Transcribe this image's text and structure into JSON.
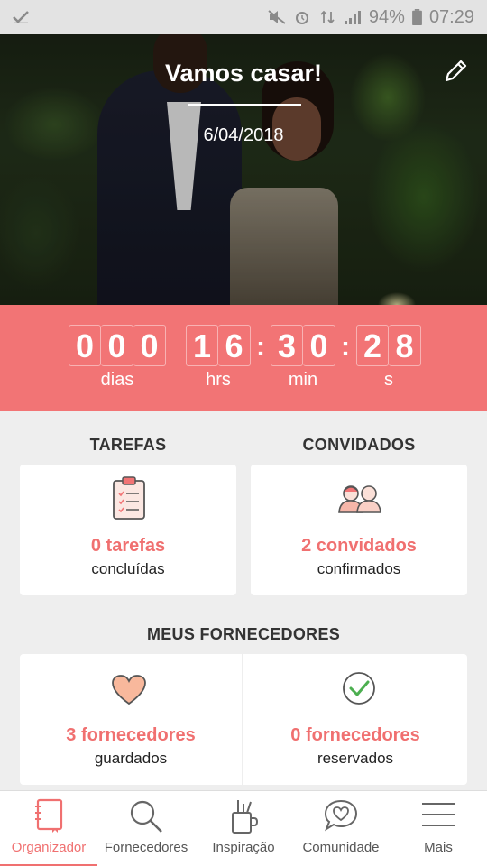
{
  "status_bar": {
    "battery": "94%",
    "time": "07:29"
  },
  "hero": {
    "title": "Vamos casar!",
    "date": "6/04/2018"
  },
  "countdown": {
    "days": [
      "0",
      "0",
      "0"
    ],
    "hours": [
      "1",
      "6"
    ],
    "minutes": [
      "3",
      "0"
    ],
    "seconds": [
      "2",
      "8"
    ],
    "labels": {
      "days": "dias",
      "hours": "hrs",
      "minutes": "min",
      "seconds": "s"
    }
  },
  "tasks": {
    "title": "TAREFAS",
    "value": "0 tarefas",
    "sub": "concluídas"
  },
  "guests": {
    "title": "CONVIDADOS",
    "value": "2 convidados",
    "sub": "confirmados"
  },
  "vendors": {
    "title": "MEUS FORNECEDORES",
    "saved": {
      "value": "3 fornecedores",
      "sub": "guardados"
    },
    "booked": {
      "value": "0 fornecedores",
      "sub": "reservados"
    }
  },
  "nav": {
    "items": [
      {
        "label": "Organizador",
        "icon": "notebook-icon",
        "active": true
      },
      {
        "label": "Fornecedores",
        "icon": "search-icon",
        "active": false
      },
      {
        "label": "Inspiração",
        "icon": "inspiration-icon",
        "active": false
      },
      {
        "label": "Comunidade",
        "icon": "chat-heart-icon",
        "active": false
      },
      {
        "label": "Mais",
        "icon": "menu-icon",
        "active": false
      }
    ]
  },
  "colors": {
    "accent": "#f27475",
    "accent_text": "#f07070"
  }
}
